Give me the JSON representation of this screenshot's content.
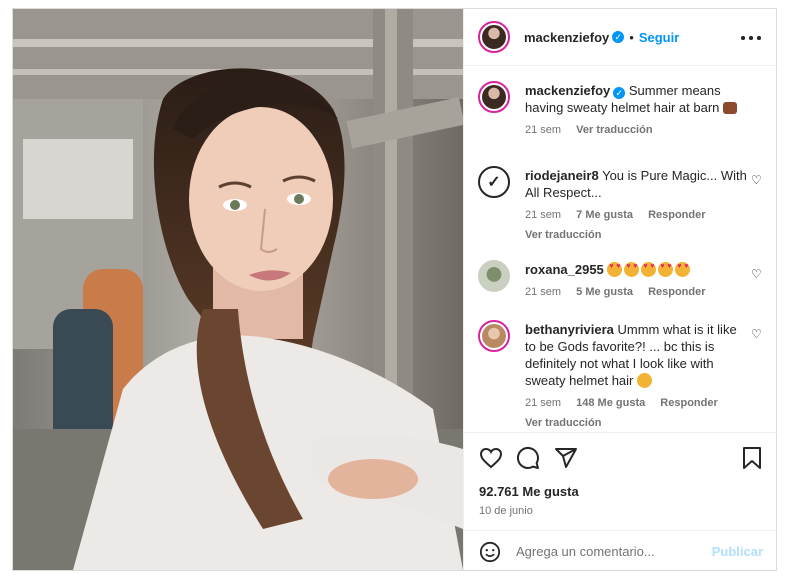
{
  "post": {
    "author": "mackenziefoy",
    "follow_label": "Seguir",
    "separator": "•"
  },
  "caption": {
    "user": "mackenziefoy",
    "text": "Summer means having sweaty helmet hair at barn",
    "age": "21 sem",
    "translate": "Ver traducción"
  },
  "comments": [
    {
      "user": "riodejaneir8",
      "text": "You is Pure Magic... With All Respect...",
      "age": "21 sem",
      "likes": "7 Me gusta",
      "reply": "Responder",
      "translate": "Ver traducción"
    },
    {
      "user": "roxana_2955",
      "text": "",
      "age": "21 sem",
      "likes": "5 Me gusta",
      "reply": "Responder"
    },
    {
      "user": "bethanyriviera",
      "text": "Ummm what is it like to be Gods favorite?! ... bc this is definitely not what I look like with sweaty helmet hair",
      "age": "21 sem",
      "likes": "148 Me gusta",
      "reply": "Responder",
      "translate": "Ver traducción"
    }
  ],
  "stats": {
    "likes": "92.761 Me gusta",
    "date": "10 de junio"
  },
  "add_comment": {
    "placeholder": "Agrega un comentario...",
    "publish": "Publicar"
  },
  "icons": [
    "verified-icon",
    "more-options-icon",
    "heart-icon",
    "comment-icon",
    "share-icon",
    "bookmark-icon",
    "emoji-icon"
  ],
  "colors": {
    "link": "#0095f6",
    "muted": "#737373",
    "publish_disabled": "#b2dffc"
  }
}
